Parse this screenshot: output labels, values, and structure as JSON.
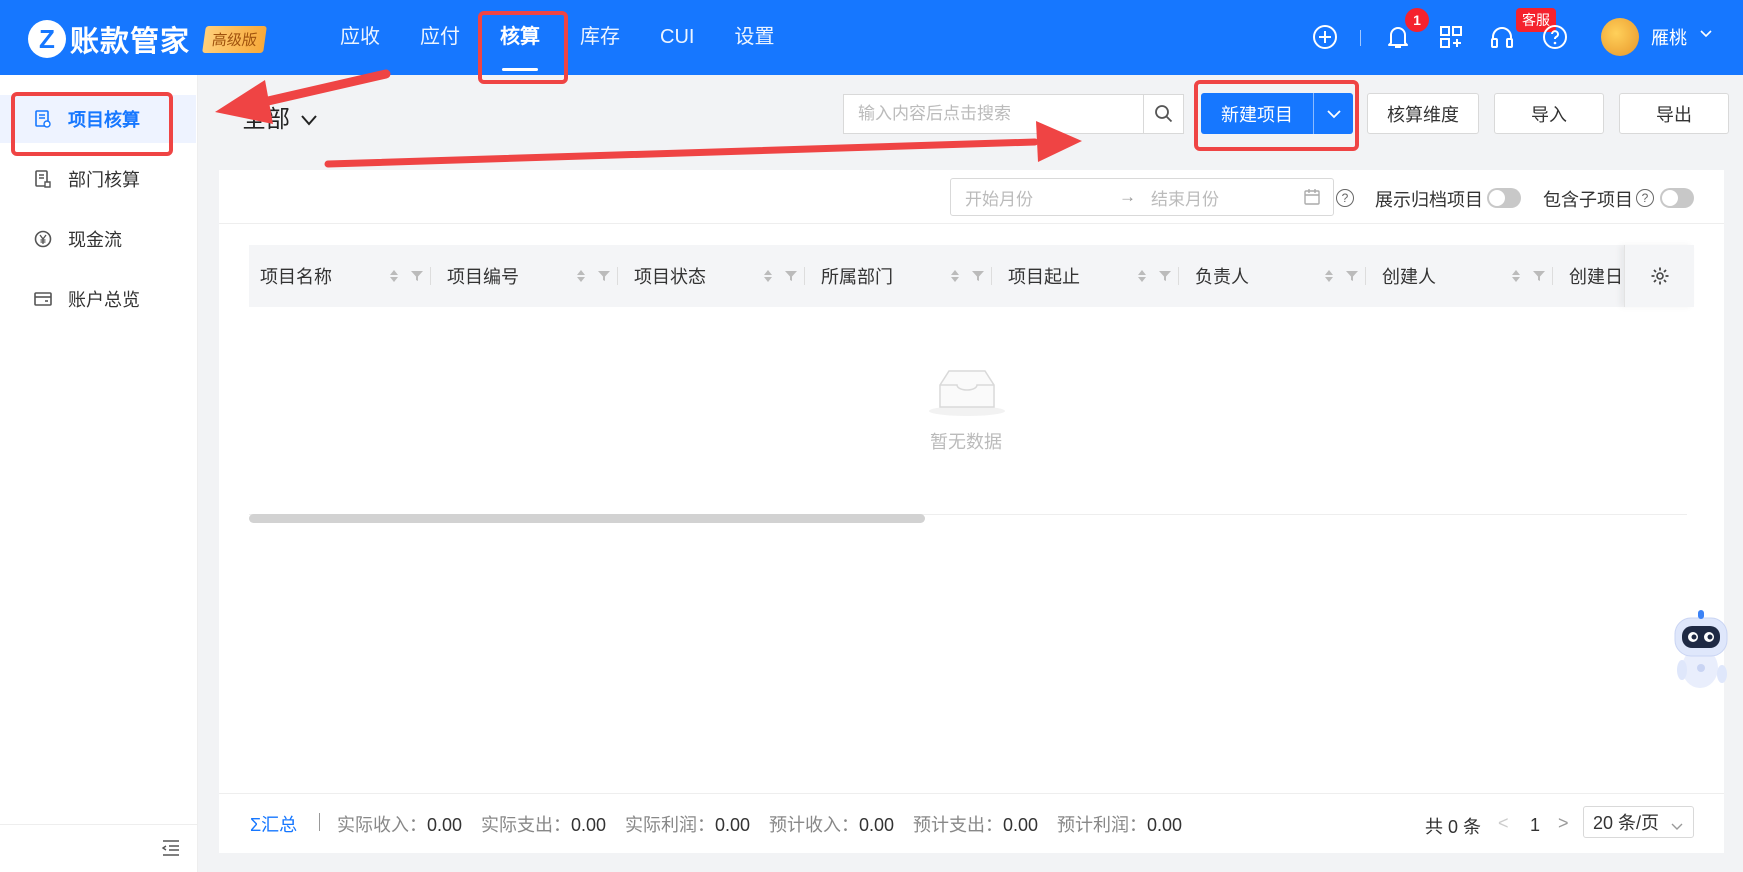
{
  "header": {
    "logo_mark": "Z",
    "app_name": "账款管家",
    "edition_badge": "高级版",
    "nav": [
      {
        "label": "应收"
      },
      {
        "label": "应付"
      },
      {
        "label": "核算",
        "active": true
      },
      {
        "label": "库存"
      },
      {
        "label": "CUI"
      },
      {
        "label": "设置"
      }
    ],
    "notification_count": "1",
    "service_badge": "客服",
    "user_name": "雁桃",
    "icons": [
      "add-circle-icon",
      "bell-icon",
      "apps-grid-icon",
      "headset-icon",
      "help-icon",
      "chevron-down-icon"
    ],
    "brand_color": "#1677ff"
  },
  "sidebar": {
    "items": [
      {
        "label": "项目核算",
        "icon": "project-doc-icon",
        "active": true
      },
      {
        "label": "部门核算",
        "icon": "department-icon"
      },
      {
        "label": "现金流",
        "icon": "cashflow-yen-icon"
      },
      {
        "label": "账户总览",
        "icon": "account-card-icon"
      }
    ],
    "collapse_icon": "collapse-menu-icon"
  },
  "toolbar": {
    "filter_title": "全部",
    "search_placeholder": "输入内容后点击搜索",
    "new_project": "新建项目",
    "dimension": "核算维度",
    "import": "导入",
    "export": "导出"
  },
  "filters": {
    "month_start_placeholder": "开始月份",
    "month_arrow": "→",
    "month_end_placeholder": "结束月份",
    "show_archived": "展示归档项目",
    "include_children": "包含子项目",
    "show_archived_on": false,
    "include_children_on": false
  },
  "table": {
    "columns": [
      "项目名称",
      "项目编号",
      "项目状态",
      "所属部门",
      "项目起止",
      "负责人",
      "创建人",
      "创建日"
    ],
    "rows": [],
    "empty_text": "暂无数据"
  },
  "summary": {
    "label": "Σ汇总",
    "items": [
      {
        "label": "实际收入：",
        "value": "0.00"
      },
      {
        "label": "实际支出：",
        "value": "0.00"
      },
      {
        "label": "实际利润：",
        "value": "0.00"
      },
      {
        "label": "预计收入：",
        "value": "0.00"
      },
      {
        "label": "预计支出：",
        "value": "0.00"
      },
      {
        "label": "预计利润：",
        "value": "0.00"
      }
    ]
  },
  "pagination": {
    "total": "共 0 条",
    "prev": "<",
    "page": "1",
    "next": ">",
    "page_size": "20 条/页"
  },
  "annotation_color": "#ef4444"
}
